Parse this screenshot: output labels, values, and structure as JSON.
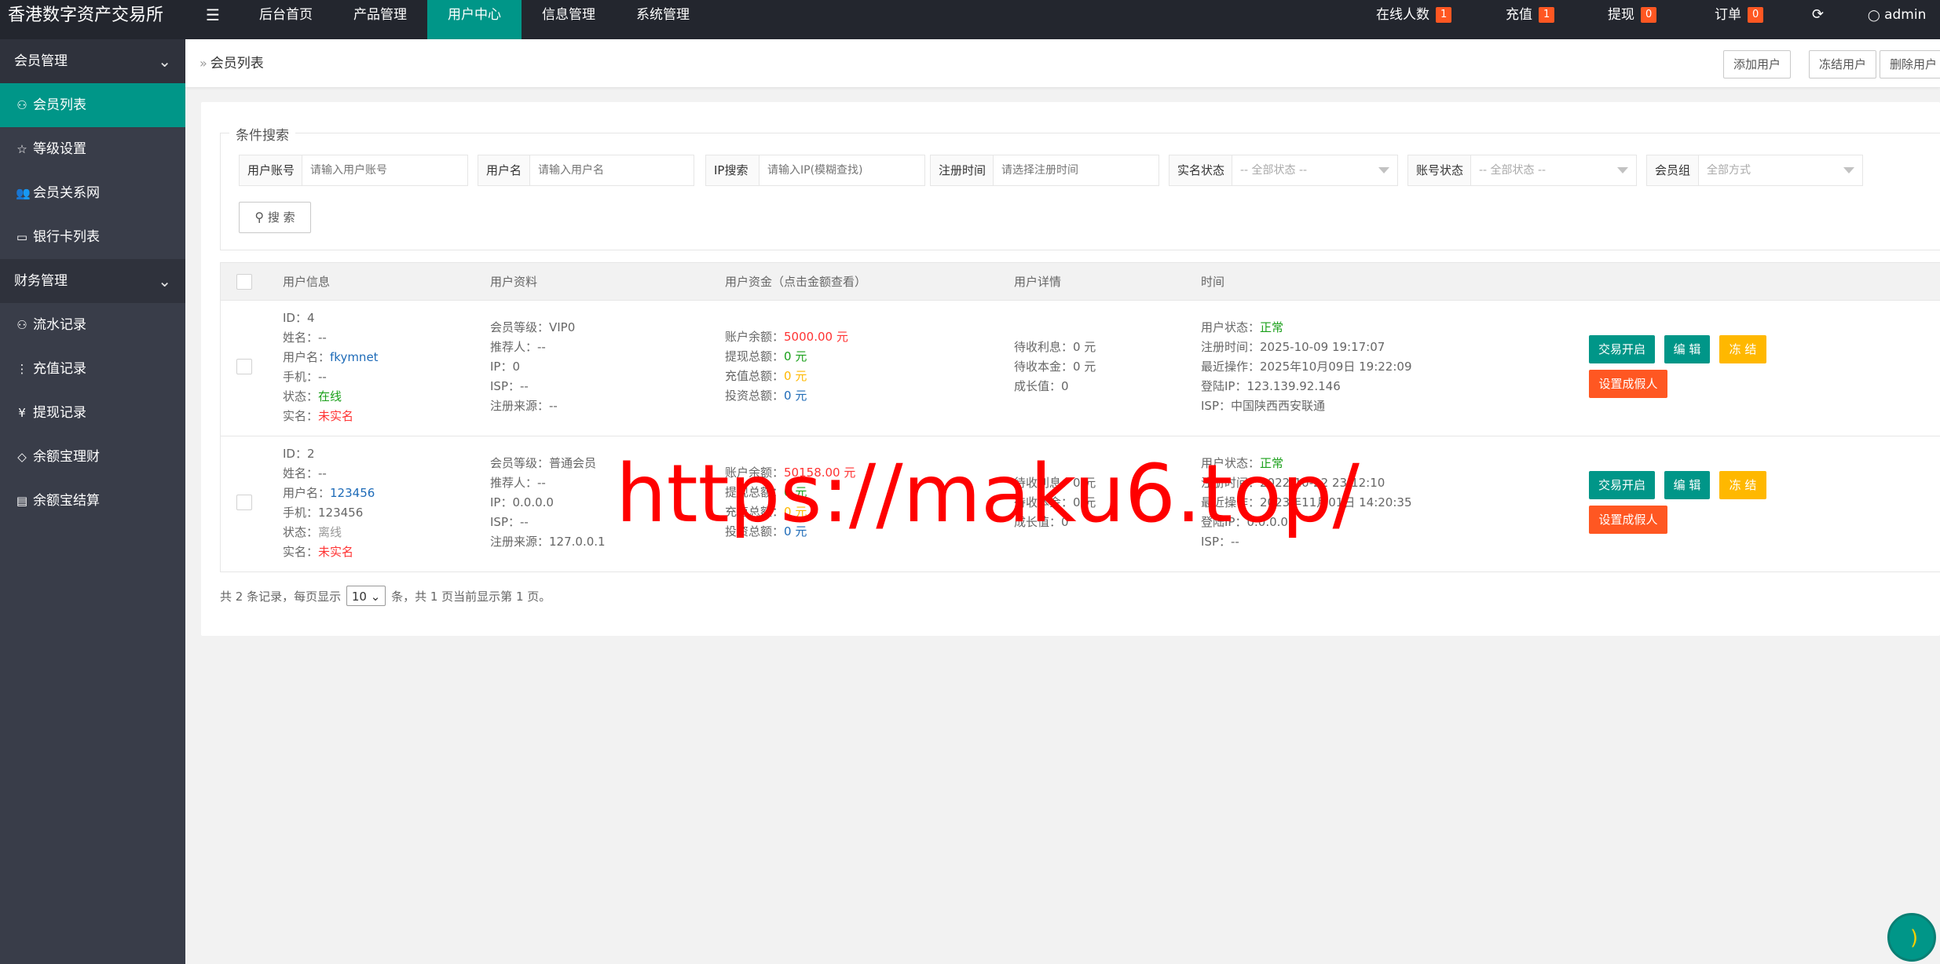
{
  "brand": "香港数字资产交易所",
  "nav": [
    {
      "label": "后台首页"
    },
    {
      "label": "产品管理"
    },
    {
      "label": "用户中心",
      "active": true
    },
    {
      "label": "信息管理"
    },
    {
      "label": "系统管理"
    }
  ],
  "top_right": {
    "online": {
      "label": "在线人数",
      "count": "1"
    },
    "recharge": {
      "label": "充值",
      "count": "1"
    },
    "withdraw": {
      "label": "提现",
      "count": "0"
    },
    "order": {
      "label": "订单",
      "count": "0"
    },
    "user": "admin"
  },
  "sidebar": {
    "groups": [
      {
        "title": "会员管理",
        "items": [
          {
            "label": "会员列表",
            "icon": "user-icon",
            "active": true
          },
          {
            "label": "等级设置",
            "icon": "star-icon"
          },
          {
            "label": "会员关系网",
            "icon": "users-icon"
          },
          {
            "label": "银行卡列表",
            "icon": "card-icon"
          }
        ]
      },
      {
        "title": "财务管理",
        "items": [
          {
            "label": "流水记录",
            "icon": "user-icon"
          },
          {
            "label": "充值记录",
            "icon": "vertical-dots-icon"
          },
          {
            "label": "提现记录",
            "icon": "yen-icon"
          },
          {
            "label": "余额宝理财",
            "icon": "diamond-icon"
          },
          {
            "label": "余额宝结算",
            "icon": "keyboard-icon"
          }
        ]
      }
    ]
  },
  "breadcrumb": "会员列表",
  "header_buttons": {
    "add": "添加用户",
    "freeze": "冻结用户",
    "delete": "删除用户"
  },
  "search": {
    "legend": "条件搜索",
    "fields": [
      {
        "label": "用户账号",
        "placeholder": "请输入用户账号"
      },
      {
        "label": "用户名",
        "placeholder": "请输入用户名"
      },
      {
        "label": "IP搜索",
        "placeholder": "请输入IP(模糊查找)"
      },
      {
        "label": "注册时间",
        "placeholder": "请选择注册时间"
      },
      {
        "label": "实名状态",
        "value": "-- 全部状态 --"
      },
      {
        "label": "账号状态",
        "value": "-- 全部状态 --"
      },
      {
        "label": "会员组",
        "value": "全部方式"
      }
    ],
    "button": "搜 索"
  },
  "table": {
    "headers": [
      "用户信息",
      "用户资料",
      "用户资金（点击金额查看）",
      "用户详情",
      "时间"
    ],
    "rows": [
      {
        "id": "ID：4",
        "name": "姓名：--",
        "username_label": "用户名：",
        "username": "fkymnet",
        "phone": "手机：--",
        "status_label": "状态：",
        "status": "在线",
        "realname_label": "实名：",
        "realname": "未实名",
        "level": "会员等级：VIP0",
        "referrer": "推荐人：--",
        "ip": "IP：0",
        "isp": "ISP：--",
        "source": "注册来源：--",
        "balance_label": "账户余额：",
        "balance": "5000.00 元",
        "withdraw_label": "提现总额：",
        "withdraw": "0 元",
        "recharge_label": "充值总额：",
        "recharge": "0 元",
        "invest_label": "投资总额：",
        "invest": "0 元",
        "interest": "待收利息：0 元",
        "principal": "待收本金：0 元",
        "growth": "成长值：0",
        "acct_status_label": "用户状态：",
        "acct_status": "正常",
        "reg_time": "注册时间：2025-10-09 19:17:07",
        "last_op": "最近操作：2025年10月09日 19:22:09",
        "login_ip": "登陆IP：123.139.92.146",
        "login_isp": "ISP：中国陕西西安联通"
      },
      {
        "id": "ID：2",
        "name": "姓名：--",
        "username_label": "用户名：",
        "username": "123456",
        "phone": "手机：123456",
        "status_label": "状态：",
        "status": "离线",
        "realname_label": "实名：",
        "realname": "未实名",
        "level": "会员等级：普通会员",
        "referrer": "推荐人：--",
        "ip": "IP：0.0.0.0",
        "isp": "ISP：--",
        "source": "注册来源：127.0.0.1",
        "balance_label": "账户余额：",
        "balance": "50158.00 元",
        "withdraw_label": "提现总额：",
        "withdraw": "0 元",
        "recharge_label": "充值总额：",
        "recharge": "0 元",
        "invest_label": "投资总额：",
        "invest": "0 元",
        "interest": "待收利息：0 元",
        "principal": "待收本金：0 元",
        "growth": "成长值：0",
        "acct_status_label": "用户状态：",
        "acct_status": "正常",
        "reg_time": "注册时间：2022-10-22 23:12:10",
        "last_op": "最近操作：2023年11月01日 14:20:35",
        "login_ip": "登陆IP：0.0.0.0",
        "login_isp": "ISP：--"
      }
    ],
    "actions": {
      "trade": "交易开启",
      "edit": "编 辑",
      "freeze": "冻 结",
      "fake": "设置成假人"
    }
  },
  "pager": {
    "prefix": "共 2 条记录，每页显示",
    "page_size": "10",
    "suffix": "条，共 1 页当前显示第 1 页。"
  },
  "watermark": "https://maku6.top/",
  "colors": {
    "topbar": "#23262e",
    "sidebar": "#393d49",
    "accent": "#009688",
    "badge": "#ff5722",
    "warning": "#ffb800"
  }
}
